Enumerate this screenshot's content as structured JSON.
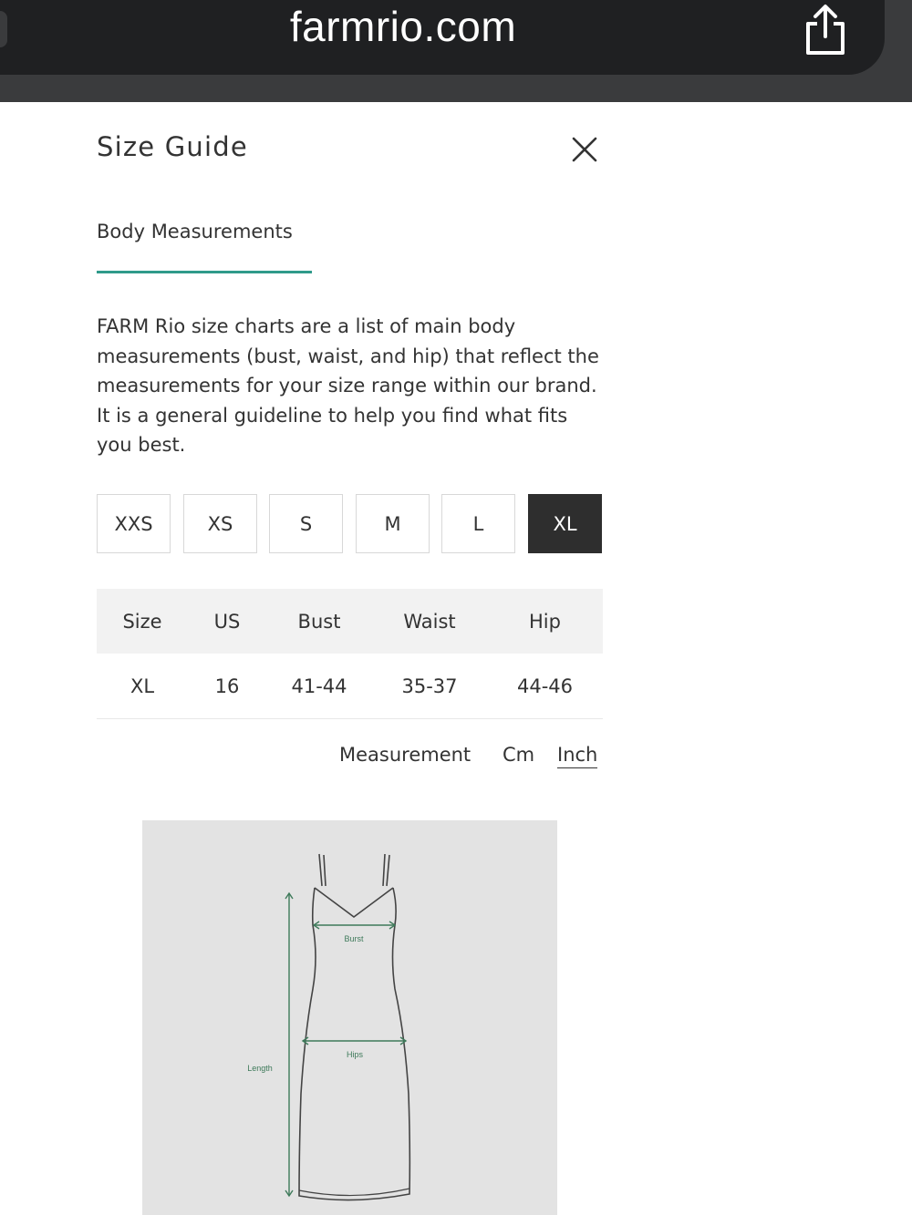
{
  "browser": {
    "url": "farmrio.com",
    "share_icon": "share-icon"
  },
  "size_guide": {
    "title": "Size Guide",
    "close_icon": "close-icon",
    "tab_label": "Body Measurements",
    "description": "FARM Rio size charts are a list of main body measurements (bust, waist, and hip) that reflect the measurements for your size range within our brand. It is a general guideline to help you find what fits you best.",
    "sizes": [
      "XXS",
      "XS",
      "S",
      "M",
      "L",
      "XL"
    ],
    "selected_size": "XL",
    "table": {
      "headers": [
        "Size",
        "US",
        "Bust",
        "Waist",
        "Hip"
      ],
      "rows": [
        [
          "XL",
          "16",
          "41-44",
          "35-37",
          "44-46"
        ]
      ]
    },
    "measurement": {
      "label": "Measurement",
      "options": [
        "Cm",
        "Inch"
      ],
      "selected": "Inch"
    },
    "diagram": {
      "labels": {
        "bust": "Burst",
        "hips": "Hips",
        "length": "Length"
      }
    }
  },
  "colors": {
    "accent": "#2f9a8a",
    "selected_bg": "#2e2e2e",
    "diagram_bg": "#e3e3e3",
    "diagram_annotation": "#3e7a5a"
  }
}
